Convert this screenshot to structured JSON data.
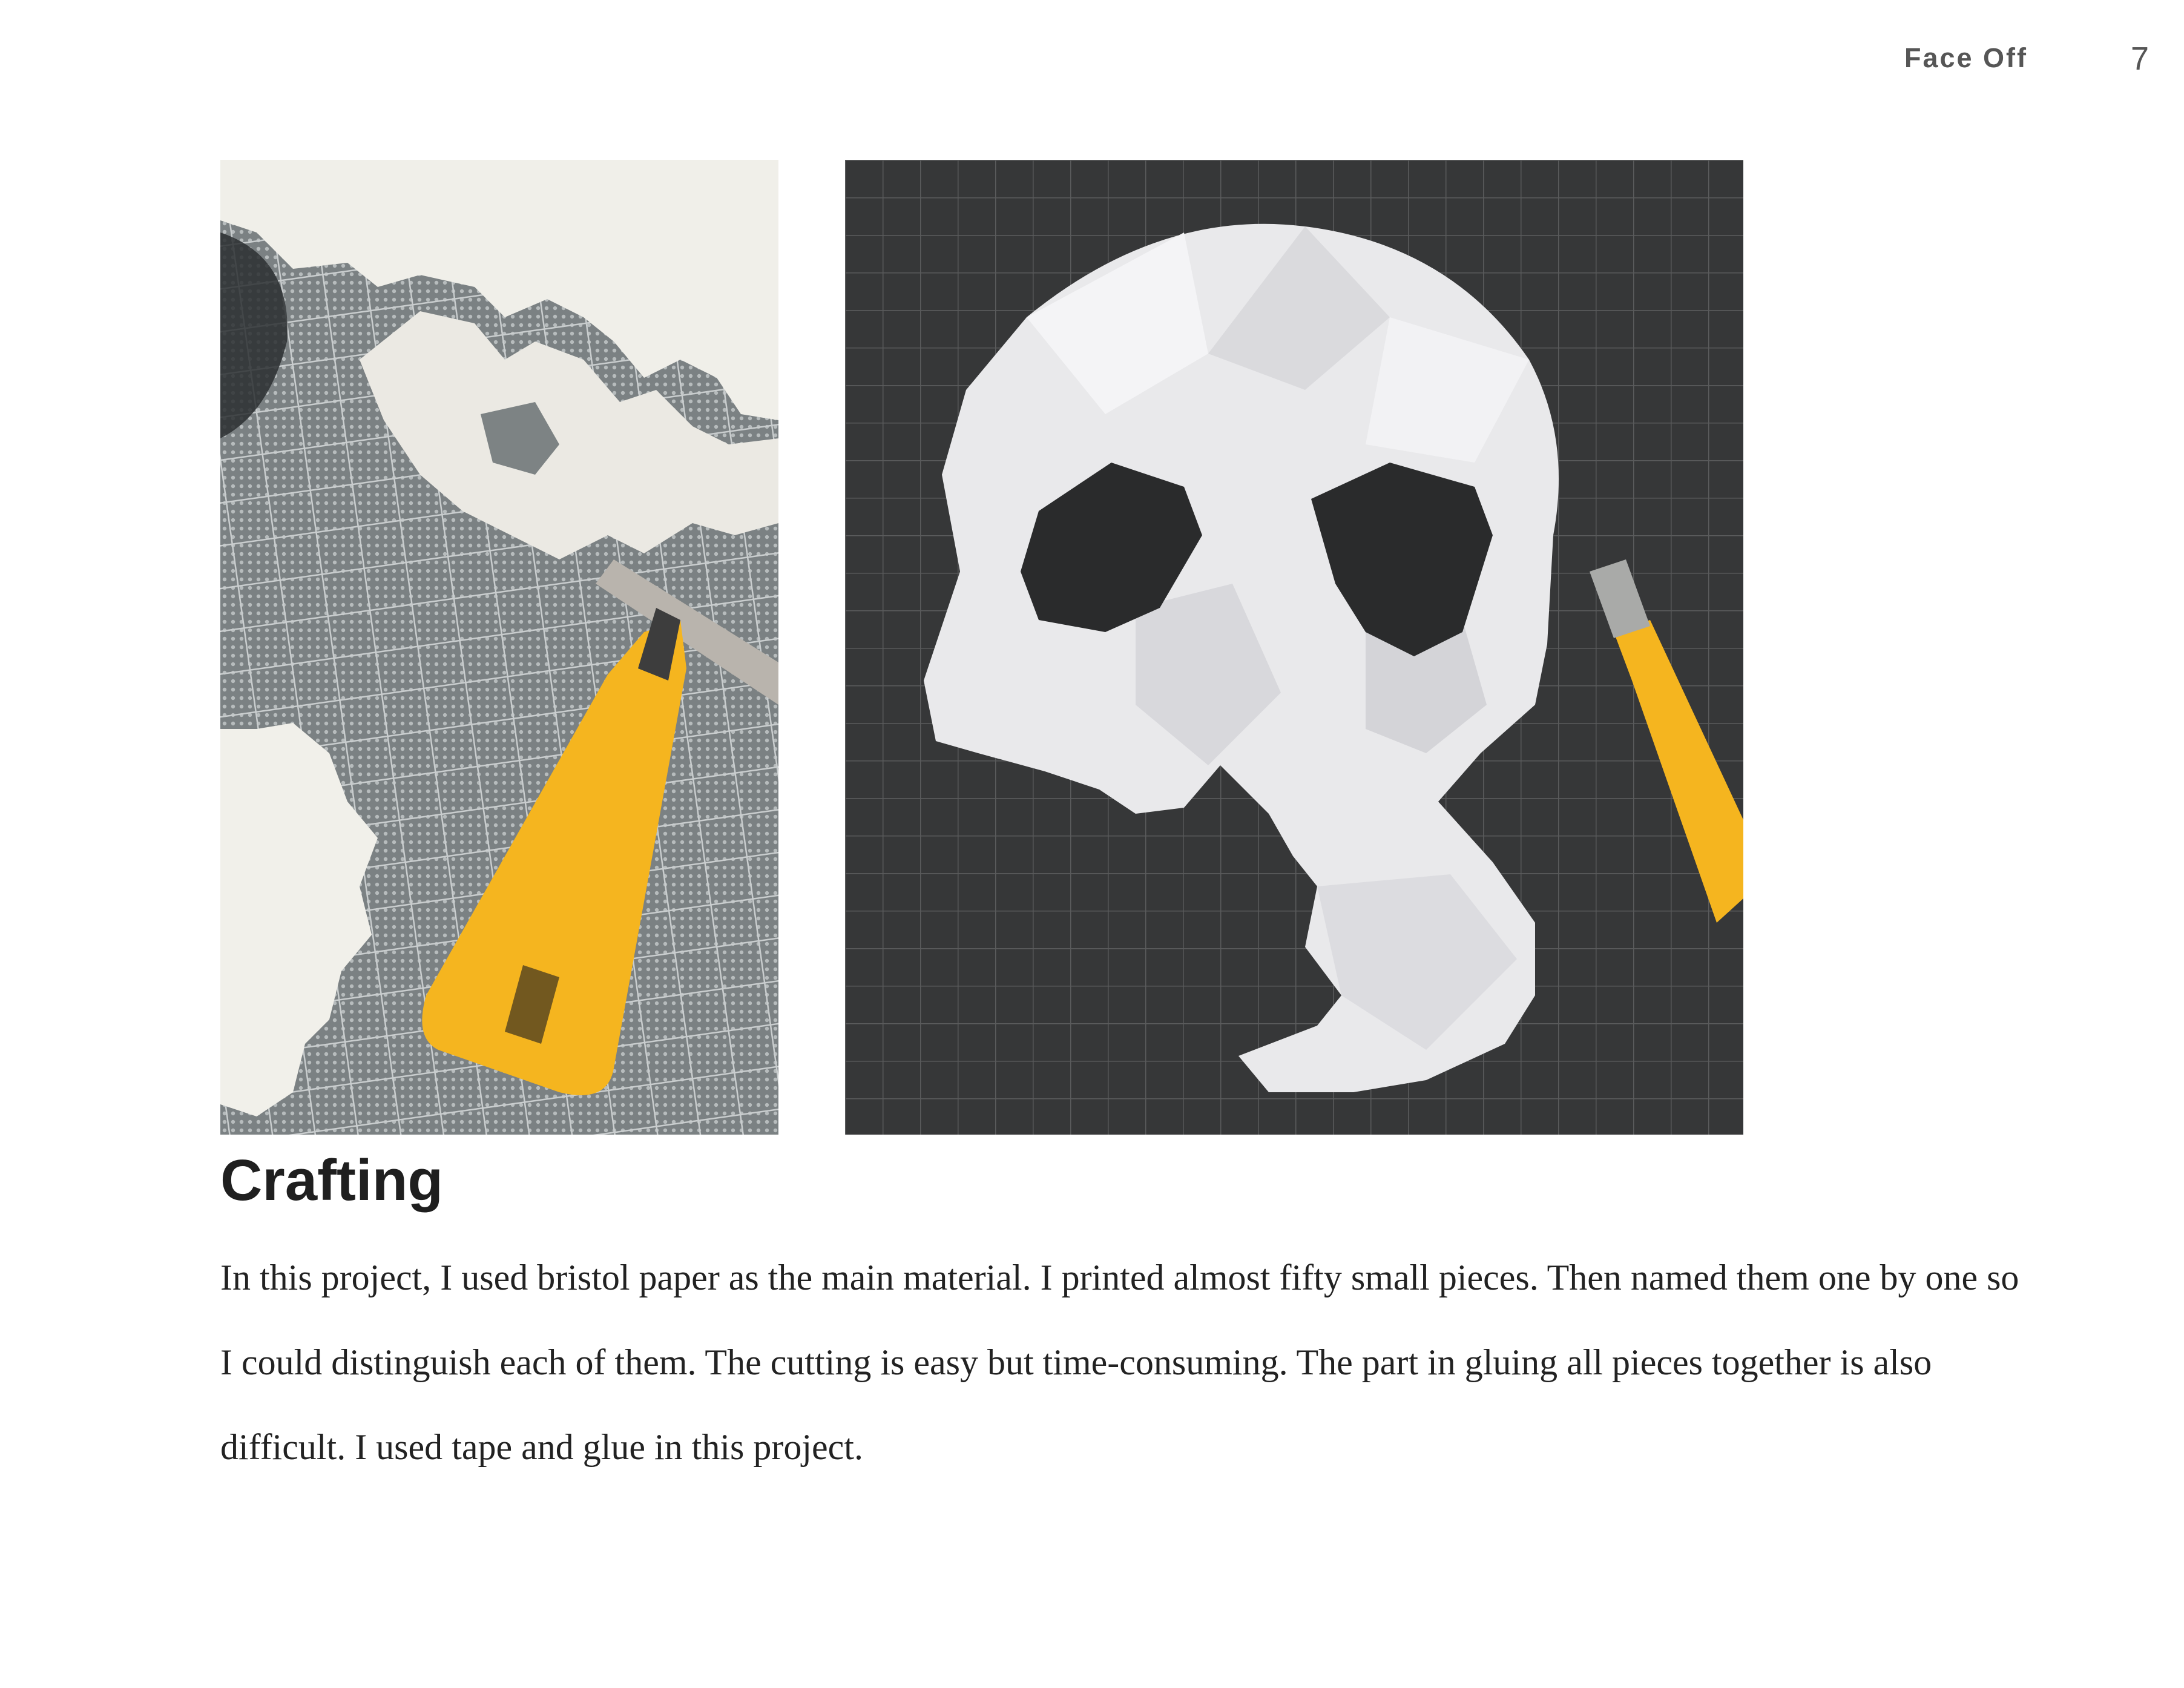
{
  "header": {
    "title": "Face Off",
    "page_number": "7"
  },
  "photos": [
    {
      "name": "paper-pieces-and-knife-photo",
      "colors": {
        "mat": "#7d8384",
        "paper": "#f0efe9",
        "knife": "#f5b51f"
      }
    },
    {
      "name": "paper-skull-mask-photo",
      "colors": {
        "mat": "#353637",
        "paper": "#e9e9eb",
        "knife": "#f5b51f"
      }
    }
  ],
  "section": {
    "heading": "Crafting",
    "body": "In this project,  I used bristol paper as the main material. I printed almost fifty small pieces. Then named them one by one so I could distinguish each of them. The cutting is easy but time-consuming. The part in gluing all pieces together is also difficult. I used tape and glue in this project."
  }
}
